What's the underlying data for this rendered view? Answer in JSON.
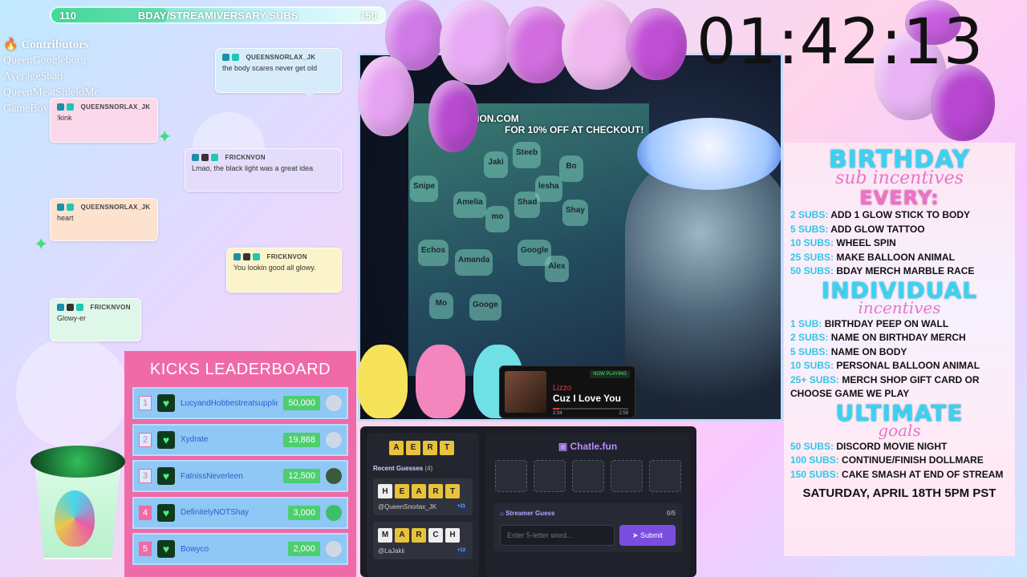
{
  "goal": {
    "start": "110",
    "label": "BDAY/STREAMIVERSARY SUBS",
    "end": "150",
    "progress_fraction": 0.35
  },
  "contributors": {
    "heading": "Contributors",
    "lines": [
      "QueenGoogleborg",
      "AverageShad",
      "QueenMeatShieldMe",
      "GameBoy"
    ]
  },
  "chat": [
    {
      "user": "QUEENSNORLAX_JK",
      "text": "the body scares never get old"
    },
    {
      "user": "QUEENSNORLAX_JK",
      "text": "!kink"
    },
    {
      "user": "FRICKNVON",
      "text": "Lmao, the black light was a great idea"
    },
    {
      "user": "QUEENSNORLAX_JK",
      "text": "heart"
    },
    {
      "user": "FRICKNVON",
      "text": "You lookin good all glowy."
    },
    {
      "user": "FRICKNVON",
      "text": "Glowy-er"
    }
  ],
  "cam": {
    "promo_line1": "ATION.COM",
    "promo_line2": "FOR 10% OFF AT CHECKOUT!",
    "peeps": [
      "Jaki",
      "Steeb",
      "Snipe",
      "Amelia",
      "Bo",
      "lesha",
      "Shad",
      "Shay",
      "mo",
      "Echos",
      "Amanda",
      "Google",
      "Alex",
      "Mo",
      "Googe"
    ]
  },
  "timer": "01:42:13",
  "incentives": {
    "title1": "BIRTHDAY",
    "script1": "sub incentives",
    "title2": "EVERY:",
    "every": [
      {
        "k": "2 SUBS:",
        "v": "ADD 1 GLOW STICK TO BODY"
      },
      {
        "k": "5 SUBS:",
        "v": "ADD GLOW TATTOO"
      },
      {
        "k": "10 SUBS:",
        "v": "WHEEL SPIN"
      },
      {
        "k": "25 SUBS:",
        "v": "MAKE BALLOON ANIMAL"
      },
      {
        "k": "50 SUBS:",
        "v": "BDAY MERCH MARBLE RACE"
      }
    ],
    "title3": "INDIVIDUAL",
    "script3": "incentives",
    "individual": [
      {
        "k": "1 SUB:",
        "v": "BIRTHDAY PEEP ON WALL"
      },
      {
        "k": "2 SUBS:",
        "v": "NAME ON BIRTHDAY MERCH"
      },
      {
        "k": "5 SUBS:",
        "v": "NAME ON BODY"
      },
      {
        "k": "10 SUBS:",
        "v": "PERSONAL BALLOON ANIMAL"
      },
      {
        "k": "25+ SUBS:",
        "v": "MERCH SHOP GIFT CARD OR"
      }
    ],
    "individual_cont": "CHOOSE GAME WE PLAY",
    "title4": "ULTIMATE",
    "script4": "goals",
    "ultimate": [
      {
        "k": "50 SUBS:",
        "v": "DISCORD MOVIE NIGHT"
      },
      {
        "k": "100 SUBS:",
        "v": "CONTINUE/FINISH DOLLMARE"
      },
      {
        "k": "150 SUBS:",
        "v": "CAKE SMASH AT END OF STREAM"
      }
    ],
    "date": "SATURDAY, APRIL 18TH 5PM PST"
  },
  "leaderboard": {
    "title": "KICKS LEADERBOARD",
    "rows": [
      {
        "rank": "1",
        "name": "LucyandHobbestreatsupplie",
        "value": "50,000"
      },
      {
        "rank": "2",
        "name": "Xydrate",
        "value": "19,868"
      },
      {
        "rank": "3",
        "name": "FatnissNeverleen",
        "value": "12,500"
      },
      {
        "rank": "4",
        "name": "DefinitelyNOTShay",
        "value": "3,000"
      },
      {
        "rank": "5",
        "name": "Bowyco",
        "value": "2,000"
      }
    ]
  },
  "now_playing": {
    "tag": "NOW PLAYING",
    "artist": "Lizzo",
    "song": "Cuz I Love You",
    "elapsed": "2:34",
    "duration": "2:59"
  },
  "game": {
    "word_tiles": [
      "A",
      "E",
      "R",
      "T"
    ],
    "recent_label": "Recent Guesses",
    "recent_count": "(4)",
    "guesses": [
      {
        "letters": [
          "H",
          "E",
          "A",
          "R",
          "T"
        ],
        "user": "@QueenSnorlax_JK",
        "pts": "+21"
      },
      {
        "letters": [
          "M",
          "A",
          "R",
          "C",
          "H"
        ],
        "user": "@LaJakii",
        "pts": "+13"
      }
    ],
    "brand": "Chatle.fun",
    "streamer_label": "Streamer Guess",
    "streamer_count": "0/5",
    "input_placeholder": "Enter 5-letter word...",
    "submit": "Submit"
  }
}
